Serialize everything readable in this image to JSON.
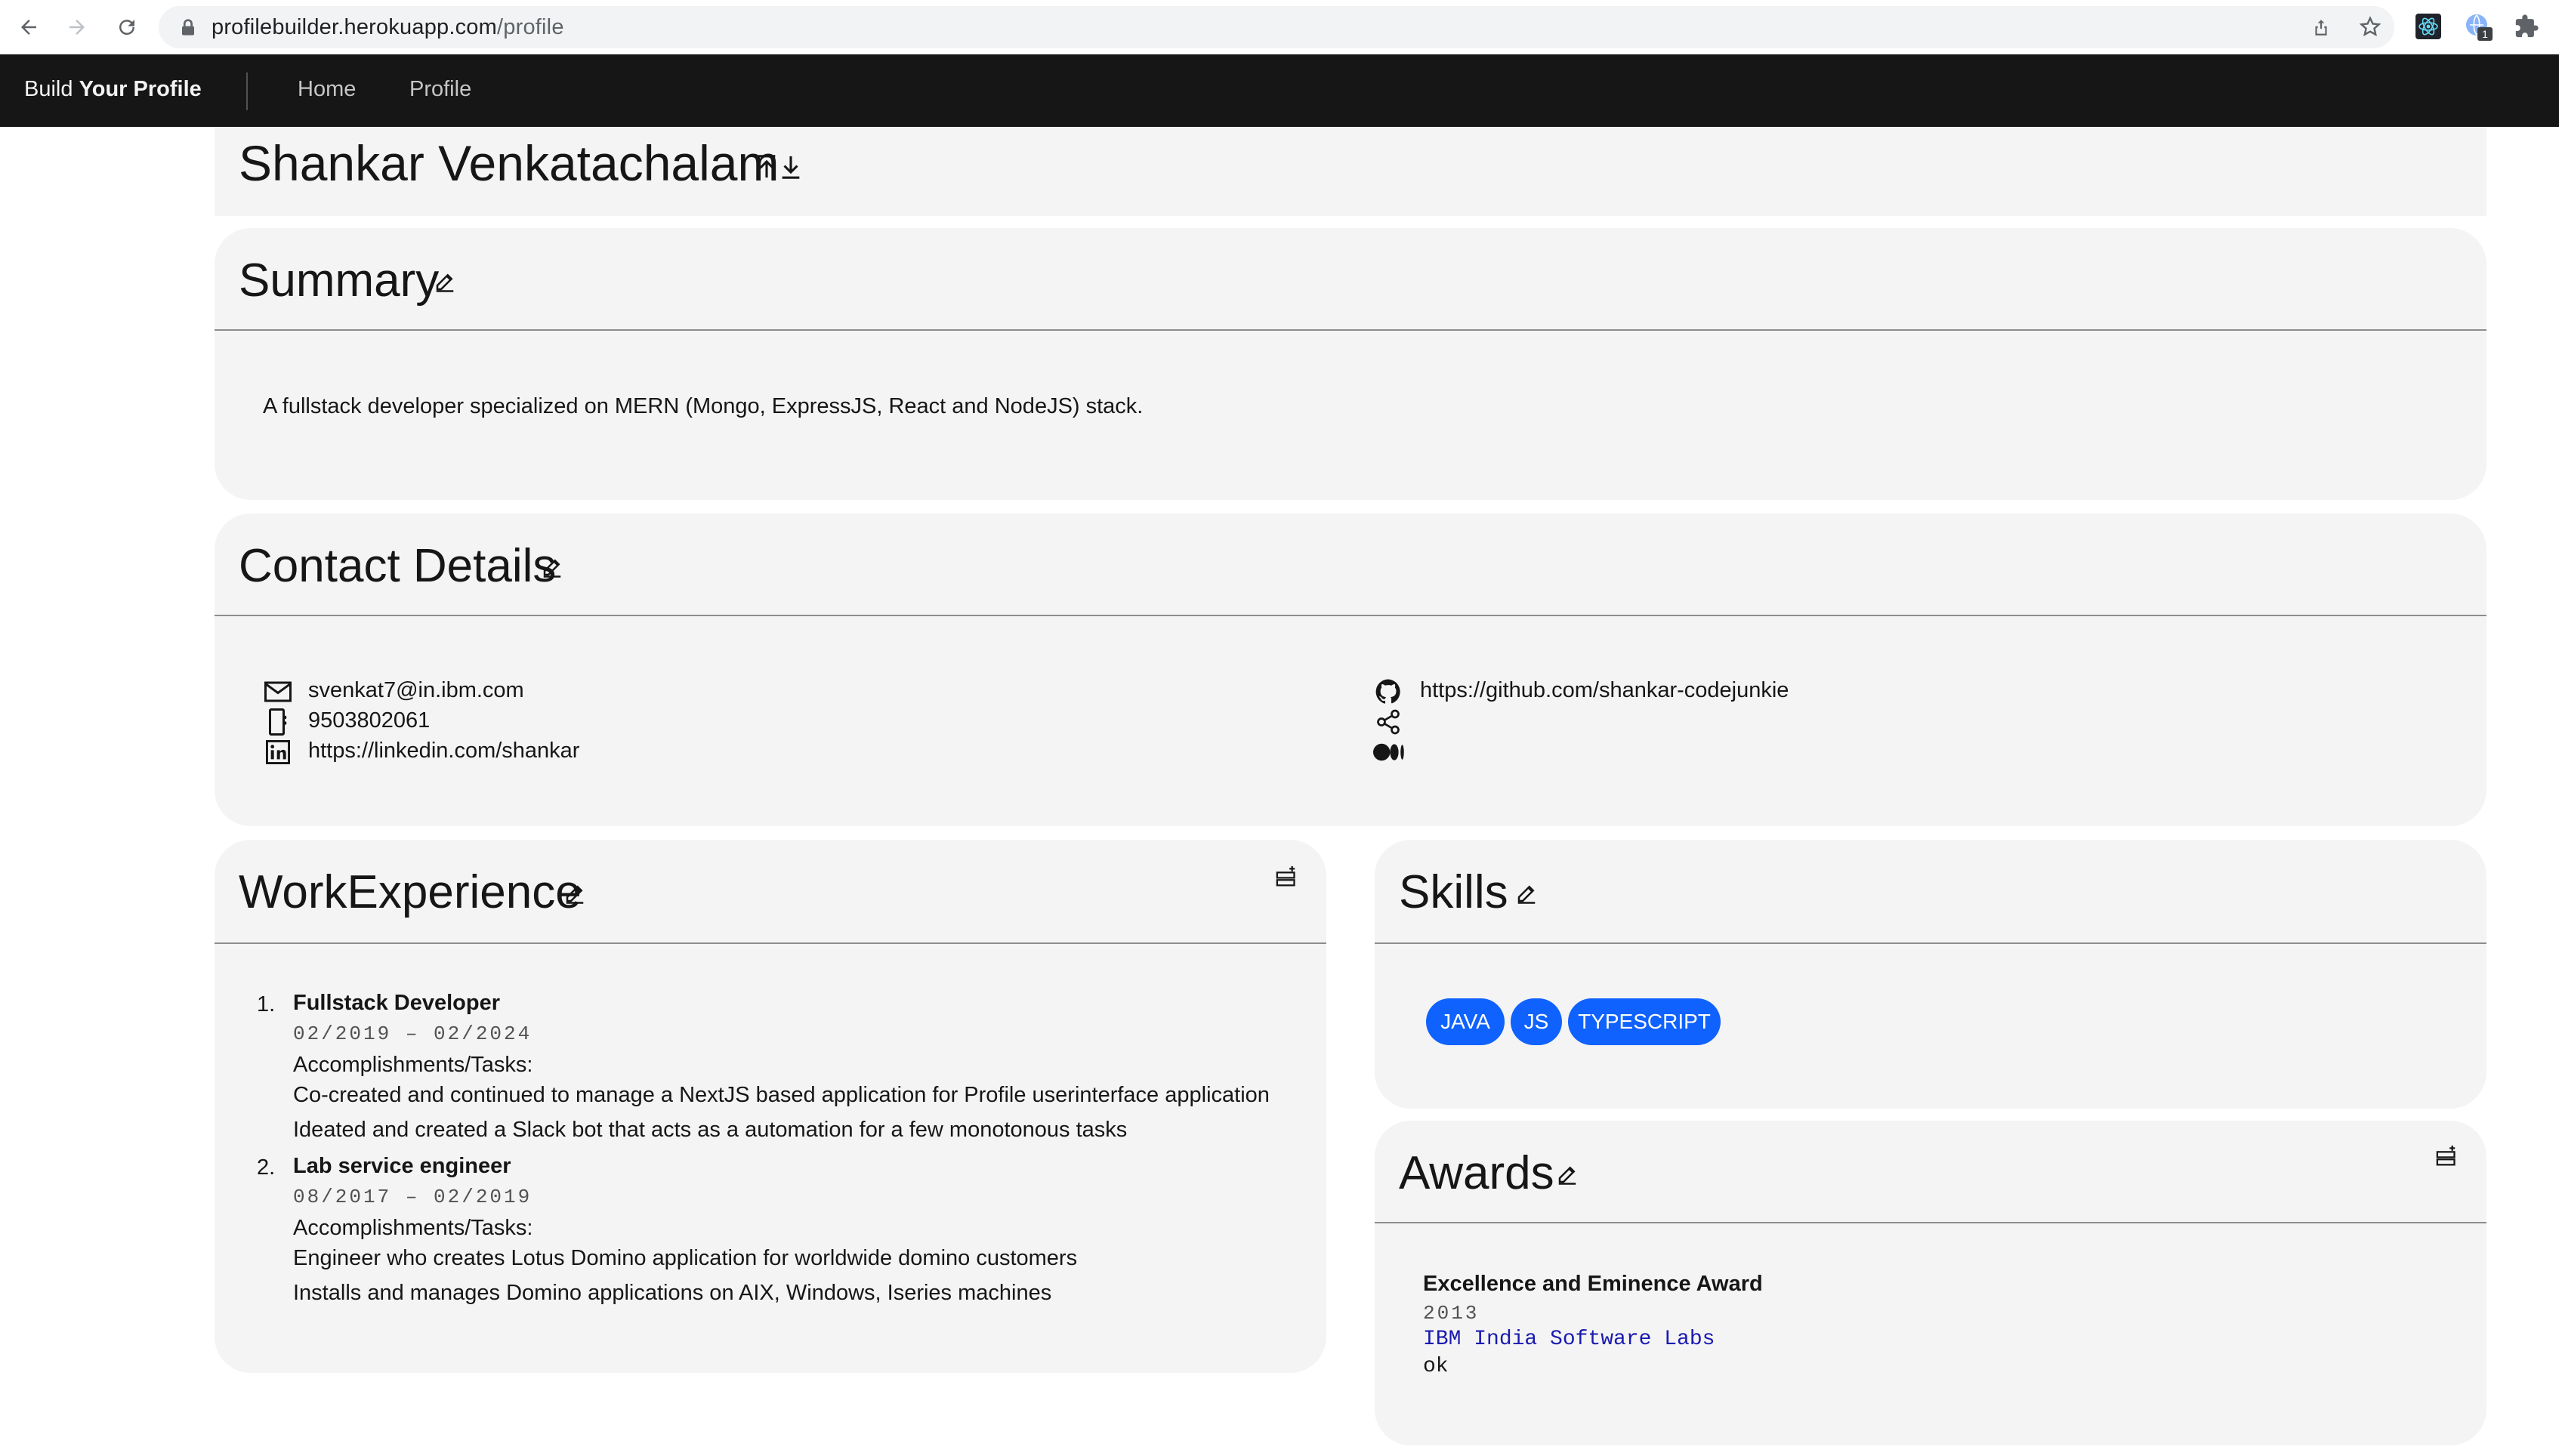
{
  "browser": {
    "url_host": "profilebuilder.herokuapp.com",
    "url_path": "/profile",
    "extension_badge": "1"
  },
  "header": {
    "brand_prefix": "Build",
    "brand_bold": "Your Profile",
    "nav": [
      {
        "label": "Home"
      },
      {
        "label": "Profile"
      }
    ]
  },
  "profile": {
    "name": "Shankar Venkatachalam"
  },
  "summary": {
    "title": "Summary",
    "text": "A fullstack developer specialized on MERN (Mongo, ExpressJS, React and NodeJS) stack."
  },
  "contact": {
    "title": "Contact Details",
    "email": "svenkat7@in.ibm.com",
    "phone": "9503802061",
    "linkedin": "https://linkedin.com/shankar",
    "github": "https://github.com/shankar-codejunkie",
    "share": "",
    "medium": ""
  },
  "work": {
    "title": "WorkExperience",
    "items": [
      {
        "index": "1.",
        "role": "Fullstack Developer",
        "dates": "02/2019 – 02/2024",
        "label": "Accomplishments/Tasks:",
        "tasks": [
          "Co-created and continued to manage a NextJS based application for Profile userinterface application",
          "Ideated and created a Slack bot that acts as a automation for a few monotonous tasks"
        ]
      },
      {
        "index": "2.",
        "role": "Lab service engineer",
        "dates": "08/2017 – 02/2019",
        "label": "Accomplishments/Tasks:",
        "tasks": [
          "Engineer who creates Lotus Domino application for worldwide domino customers",
          "Installs and manages Domino applications on AIX, Windows, Iseries machines"
        ]
      }
    ]
  },
  "skills": {
    "title": "Skills",
    "tags": [
      "JAVA",
      "JS",
      "TYPESCRIPT"
    ]
  },
  "awards": {
    "title": "Awards",
    "items": [
      {
        "name": "Excellence and Eminence Award",
        "year": "2013",
        "org": "IBM India Software Labs",
        "note": "ok"
      }
    ]
  },
  "colors": {
    "header_bg": "#161616",
    "tile_bg": "#f4f4f4",
    "tag_bg": "#0f62fe",
    "award_org": "#1a1ab0"
  }
}
